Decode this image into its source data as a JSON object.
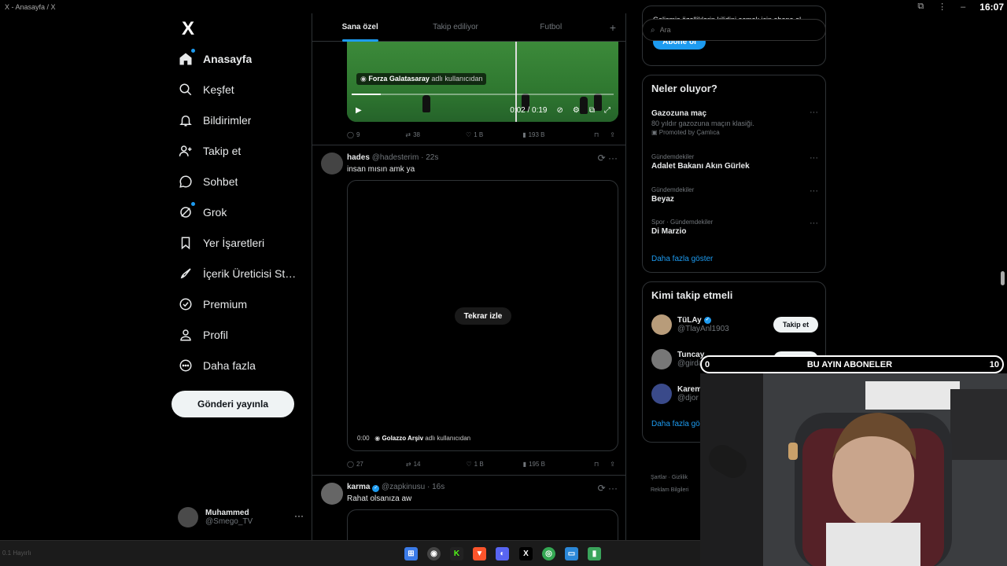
{
  "titlebar": {
    "title": "X - Anasayfa / X",
    "clock": "16:07"
  },
  "sidebar": {
    "logo": "X",
    "items": [
      {
        "label": "Anasayfa",
        "icon": "home-icon"
      },
      {
        "label": "Keşfet",
        "icon": "search-icon"
      },
      {
        "label": "Bildirimler",
        "icon": "bell-icon"
      },
      {
        "label": "Takip et",
        "icon": "person-add-icon"
      },
      {
        "label": "Sohbet",
        "icon": "chat-icon"
      },
      {
        "label": "Grok",
        "icon": "grok-icon"
      },
      {
        "label": "Yer İşaretleri",
        "icon": "bookmark-icon"
      },
      {
        "label": "İçerik Üreticisi Stü...",
        "icon": "rocket-icon"
      },
      {
        "label": "Premium",
        "icon": "verified-icon"
      },
      {
        "label": "Profil",
        "icon": "profile-icon"
      },
      {
        "label": "Daha fazla",
        "icon": "more-circle-icon"
      }
    ],
    "post_button": "Gönderi yayınla",
    "account": {
      "name": "Muhammed",
      "handle": "@Smego_TV"
    }
  },
  "feed": {
    "tabs": [
      "Sana özel",
      "Takip ediliyor",
      "Futbol",
      "+"
    ],
    "post1": {
      "credit_user": "Forza Galatasaray",
      "credit_suffix": "adlı kullanıcıdan",
      "time": "0:02 / 0:19",
      "progress": 0.11,
      "replies": "9",
      "reposts": "38",
      "likes": "1 B",
      "views": "193 B"
    },
    "post2": {
      "name": "hades",
      "handle": "@hadesterim",
      "time": "· 22s",
      "text": "insan mısın amk ya",
      "replay": "Tekrar izle",
      "video_time": "0:00",
      "credit_user": "Golazzo Arşiv",
      "credit_suffix": "adlı kullanıcıdan",
      "replies": "27",
      "reposts": "14",
      "likes": "1 B",
      "views": "195 B"
    },
    "post3": {
      "name": "karma",
      "handle": "@zapkinusu",
      "time": "· 16s",
      "text": "Rahat olsanıza aw"
    }
  },
  "right": {
    "search_placeholder": "Ara",
    "premium_top_text": "Gelişmiş özelliklerin kilidini açmak için abone ol",
    "subscribe": "Abone ol",
    "trends_title": "Neler oluyor?",
    "trends": [
      {
        "category": "",
        "title": "Gazozuna maç",
        "sub": "80 yıldır gazozuna maçın klasiği.",
        "promo": "Promoted by Çamlıca"
      },
      {
        "category": "Gündemdekiler",
        "title": "Adalet Bakanı Akın Gürlek"
      },
      {
        "category": "Gündemdekiler",
        "title": "Beyaz"
      },
      {
        "category": "Spor · Gündemdekiler",
        "title": "Di Marzio"
      }
    ],
    "show_more": "Daha fazla göster",
    "who_title": "Kimi takip etmeli",
    "who": [
      {
        "name": "TüLAy",
        "handle": "@TlayAnl1903",
        "button": "Takip et"
      },
      {
        "name": "Tuncay",
        "handle": "@girda",
        "button": "Takip et"
      },
      {
        "name": "Karem",
        "handle": "@djor"
      }
    ],
    "who_more": "Daha fazla gö",
    "footer_line1": "Şartlar  ·  Gizlilik",
    "footer_line2": "Reklam Bilgileri"
  },
  "overlay": {
    "left": "0",
    "title": "BU AYIN ABONELER",
    "right": "10"
  },
  "taskbar": {
    "left_text": "0.1 Hayırlı"
  }
}
